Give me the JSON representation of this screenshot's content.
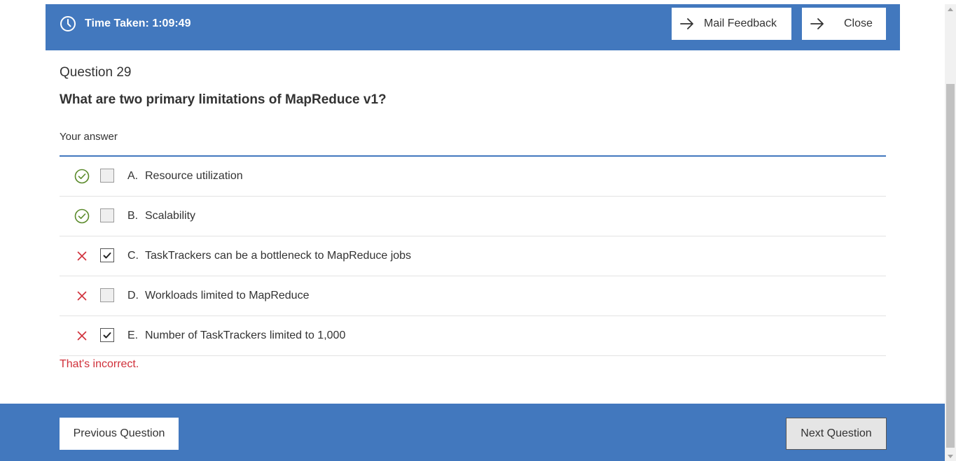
{
  "header": {
    "timer_text": "Time Taken: 1:09:49",
    "mail_feedback_label": "Mail Feedback",
    "close_label": "Close"
  },
  "question": {
    "number_label": "Question 29",
    "text": "What are two primary limitations of MapReduce v1?",
    "your_answer_label": "Your answer"
  },
  "options": [
    {
      "letter": "A.",
      "text": "Resource utilization",
      "status": "correct",
      "checked": false
    },
    {
      "letter": "B.",
      "text": "Scalability",
      "status": "correct",
      "checked": false
    },
    {
      "letter": "C.",
      "text": "TaskTrackers can be a bottleneck to MapReduce jobs",
      "status": "incorrect",
      "checked": true
    },
    {
      "letter": "D.",
      "text": "Workloads limited to MapReduce",
      "status": "incorrect",
      "checked": false
    },
    {
      "letter": "E.",
      "text": "Number of TaskTrackers limited to 1,000",
      "status": "incorrect",
      "checked": true
    }
  ],
  "result": {
    "feedback_text": "That's incorrect."
  },
  "footer": {
    "previous_label": "Previous Question",
    "next_label": "Next Question"
  },
  "colors": {
    "accent": "#4278be",
    "correct": "#5a8a2a",
    "incorrect": "#d0303a"
  }
}
